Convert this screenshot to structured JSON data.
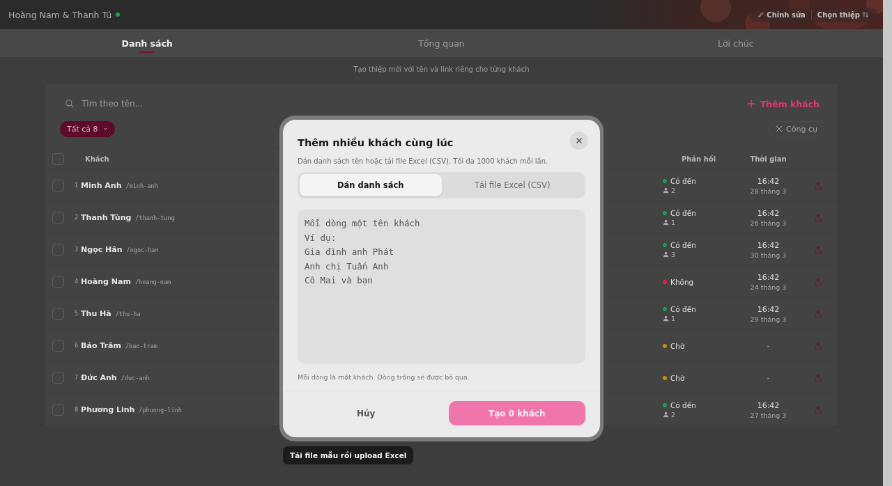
{
  "header": {
    "title": "Hoàng Nam & Thanh Tú",
    "actions": [
      {
        "label": "Chỉnh sửa"
      },
      {
        "label": "Chọn thiệp"
      }
    ]
  },
  "tabs": [
    {
      "label": "Danh sách",
      "selected": true
    },
    {
      "label": "Tổng quan",
      "selected": false
    },
    {
      "label": "Lời chúc",
      "selected": false
    }
  ],
  "subtitle": "Tạo thiệp mới với tên và link riêng cho từng khách",
  "toolbar": {
    "search_placeholder": "Tìm theo tên...",
    "add_button": "Thêm khách",
    "filter": {
      "label": "Tất cả",
      "count": "8"
    },
    "tools_button": "Công cụ"
  },
  "table": {
    "select_all_checked": false,
    "columns": [
      "Khách",
      "Phản hồi",
      "Thời gian"
    ],
    "rows": [
      {
        "checked": false,
        "index": "1",
        "name": "Minh Anh",
        "slug": "/minh-anh",
        "response": "Có đến",
        "color": "#16a34a",
        "guests": "2",
        "time": "16:42",
        "date": "28 tháng 3"
      },
      {
        "checked": false,
        "index": "2",
        "name": "Thanh Tùng",
        "slug": "/thanh-tung",
        "response": "Có đến",
        "color": "#16a34a",
        "guests": "1",
        "time": "16:42",
        "date": "26 tháng 3"
      },
      {
        "checked": false,
        "index": "3",
        "name": "Ngọc Hân",
        "slug": "/ngoc-han",
        "response": "Có đến",
        "color": "#16a34a",
        "guests": "3",
        "time": "16:42",
        "date": "30 tháng 3"
      },
      {
        "checked": false,
        "index": "4",
        "name": "Hoàng Nam",
        "slug": "/hoang-nam",
        "response": "Không",
        "color": "#e11d48",
        "time": "16:42",
        "date": "24 tháng 3"
      },
      {
        "checked": false,
        "index": "5",
        "name": "Thu Hà",
        "slug": "/thu-ha",
        "response": "Có đến",
        "color": "#16a34a",
        "guests": "1",
        "time": "16:42",
        "date": "29 tháng 3"
      },
      {
        "checked": false,
        "index": "6",
        "name": "Bảo Trâm",
        "slug": "/bao-tram",
        "response": "Chờ",
        "color": "#ca8a04",
        "time": "-"
      },
      {
        "checked": false,
        "index": "7",
        "name": "Đức Anh",
        "slug": "/duc-anh",
        "response": "Chờ",
        "color": "#ca8a04",
        "time": "-"
      },
      {
        "checked": false,
        "index": "8",
        "name": "Phương Linh",
        "slug": "/phuong-linh",
        "response": "Có đến",
        "color": "#16a34a",
        "guests": "2",
        "time": "16:42",
        "date": "27 tháng 3"
      }
    ]
  },
  "dialog": {
    "title": "Thêm nhiều khách cùng lúc",
    "description": "Dán danh sách tên hoặc tải file Excel (CSV). Tối đa 1000 khách mỗi lần.",
    "tabs": [
      {
        "label": "Dán danh sách",
        "selected": true
      },
      {
        "label": "Tải file Excel (CSV)",
        "selected": false
      }
    ],
    "textarea_placeholder": "Mỗi dòng một tên khách\nVí dụ:\nGia đình anh Phát\nAnh chị Tuấn Anh\nCô Mai và bạn",
    "hint": "Mỗi dòng là một khách. Dòng trống sẽ được bỏ qua.",
    "cancel_button": "Hủy",
    "create_button": {
      "label": "Tạo 0 khách",
      "disabled": true
    }
  },
  "tooltip": "Tải file mẫu rồi upload Excel"
}
